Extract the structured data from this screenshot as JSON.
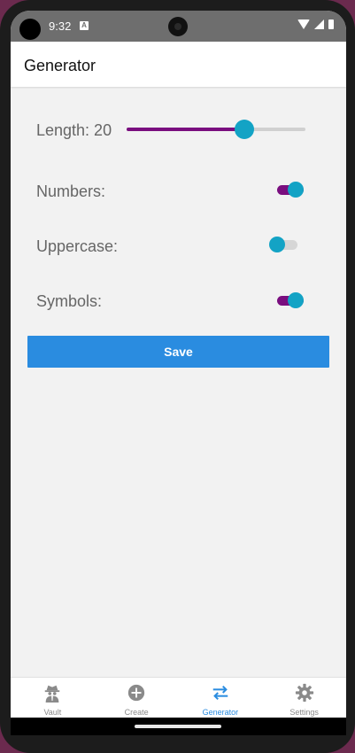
{
  "status_bar": {
    "time": "9:32",
    "notification_icon": "a-icon"
  },
  "app_bar": {
    "title": "Generator"
  },
  "generator": {
    "length_label": "Length: 20",
    "length_slider_fraction": 0.66,
    "numbers_label": "Numbers:",
    "numbers_enabled": true,
    "uppercase_label": "Uppercase:",
    "uppercase_enabled": false,
    "symbols_label": "Symbols:",
    "symbols_enabled": true,
    "save_label": "Save"
  },
  "colors": {
    "accent_blue": "#2a8ce0",
    "toggle_on_track": "#7a0e7f",
    "thumb": "#13a3c5"
  },
  "bottom_nav": [
    {
      "label": "Vault",
      "icon": "spy-icon",
      "active": false
    },
    {
      "label": "Create",
      "icon": "plus-circle-icon",
      "active": false
    },
    {
      "label": "Generator",
      "icon": "swap-arrows-icon",
      "active": true
    },
    {
      "label": "Settings",
      "icon": "gear-icon",
      "active": false
    }
  ]
}
